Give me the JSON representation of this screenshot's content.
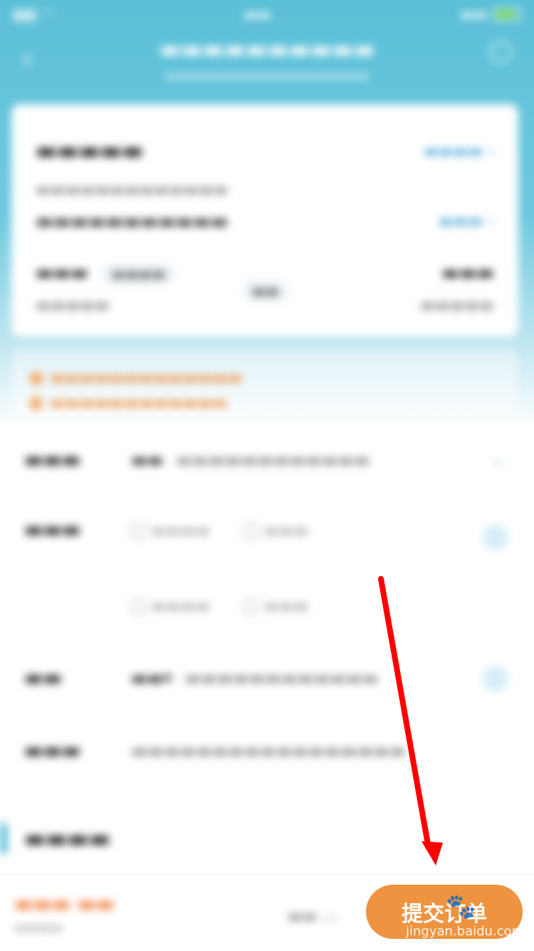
{
  "submit_button": {
    "label": "提交订单"
  },
  "watermark": {
    "text": "jingyan.baidu.com"
  },
  "colors": {
    "header": "#5cc0d8",
    "accent_orange": "#ee9340",
    "annotation_red": "#ff0000"
  },
  "icons": {
    "back": "back-arrow-icon",
    "service": "headset-icon",
    "paw": "baidu-paw-icon"
  }
}
